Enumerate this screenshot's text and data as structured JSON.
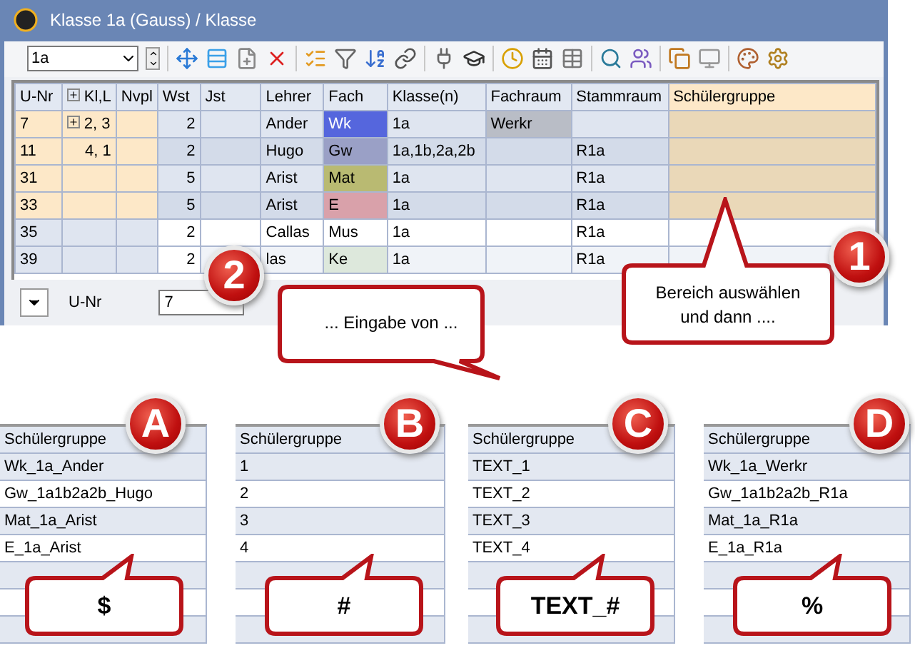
{
  "window": {
    "title": "Klasse 1a (Gauss) / Klasse"
  },
  "toolbar": {
    "class_selector": "1a"
  },
  "table": {
    "columns": [
      "U-Nr",
      "Kl,L",
      "Nvpl",
      "Wst",
      "Jst",
      "Lehrer",
      "Fach",
      "Klasse(n)",
      "Fachraum",
      "Stammraum",
      "Schülergruppe"
    ],
    "rows": [
      {
        "selected": true,
        "expanded": false,
        "color": "#5566dd",
        "cells": [
          "7",
          "2, 3",
          "",
          "2",
          "",
          "Ander",
          "Wk",
          "1a",
          "Werkr",
          "",
          ""
        ]
      },
      {
        "selected": true,
        "color": "#9aa0c6",
        "cells": [
          "11",
          "4, 1",
          "",
          "2",
          "",
          "Hugo",
          "Gw",
          "1a,1b,2a,2b",
          "",
          "R1a",
          ""
        ]
      },
      {
        "selected": true,
        "color": "#b9ba72",
        "cells": [
          "31",
          "",
          "",
          "5",
          "",
          "Arist",
          "Mat",
          "1a",
          "",
          "R1a",
          ""
        ]
      },
      {
        "selected": true,
        "color": "#d9a1aa",
        "cells": [
          "33",
          "",
          "",
          "5",
          "",
          "Arist",
          "E",
          "1a",
          "",
          "R1a",
          ""
        ]
      },
      {
        "selected": false,
        "color": "#ffffff",
        "cells": [
          "35",
          "",
          "",
          "2",
          "",
          "Callas",
          "Mus",
          "1a",
          "",
          "R1a",
          ""
        ]
      },
      {
        "selected": false,
        "color": "#dde8dc",
        "cells": [
          "39",
          "",
          "",
          "2",
          "",
          "las",
          "Ke",
          "1a",
          "",
          "R1a",
          ""
        ]
      }
    ]
  },
  "filter_bar": {
    "label": "U-Nr",
    "value": "7"
  },
  "callouts": [
    {
      "step": "1",
      "text": "Bereich auswählen und dann ...."
    },
    {
      "step": "2",
      "text": "... Eingabe von ..."
    }
  ],
  "examples": [
    {
      "step": "A",
      "header": "Schülergruppe",
      "rows": [
        "Wk_1a_Ander",
        "Gw_1a1b2a2b_Hugo",
        "Mat_1a_Arist",
        "E_1a_Arist"
      ],
      "pattern": "$"
    },
    {
      "step": "B",
      "header": "Schülergruppe",
      "rows": [
        "1",
        "2",
        "3",
        "4"
      ],
      "pattern": "#"
    },
    {
      "step": "C",
      "header": "Schülergruppe",
      "rows": [
        "TEXT_1",
        "TEXT_2",
        "TEXT_3",
        "TEXT_4"
      ],
      "pattern": "TEXT_#"
    },
    {
      "step": "D",
      "header": "Schülergruppe",
      "rows": [
        "Wk_1a_Werkr",
        "Gw_1a1b2a2b_R1a",
        "Mat_1a_R1a",
        "E_1a_R1a"
      ],
      "pattern": "%"
    }
  ]
}
